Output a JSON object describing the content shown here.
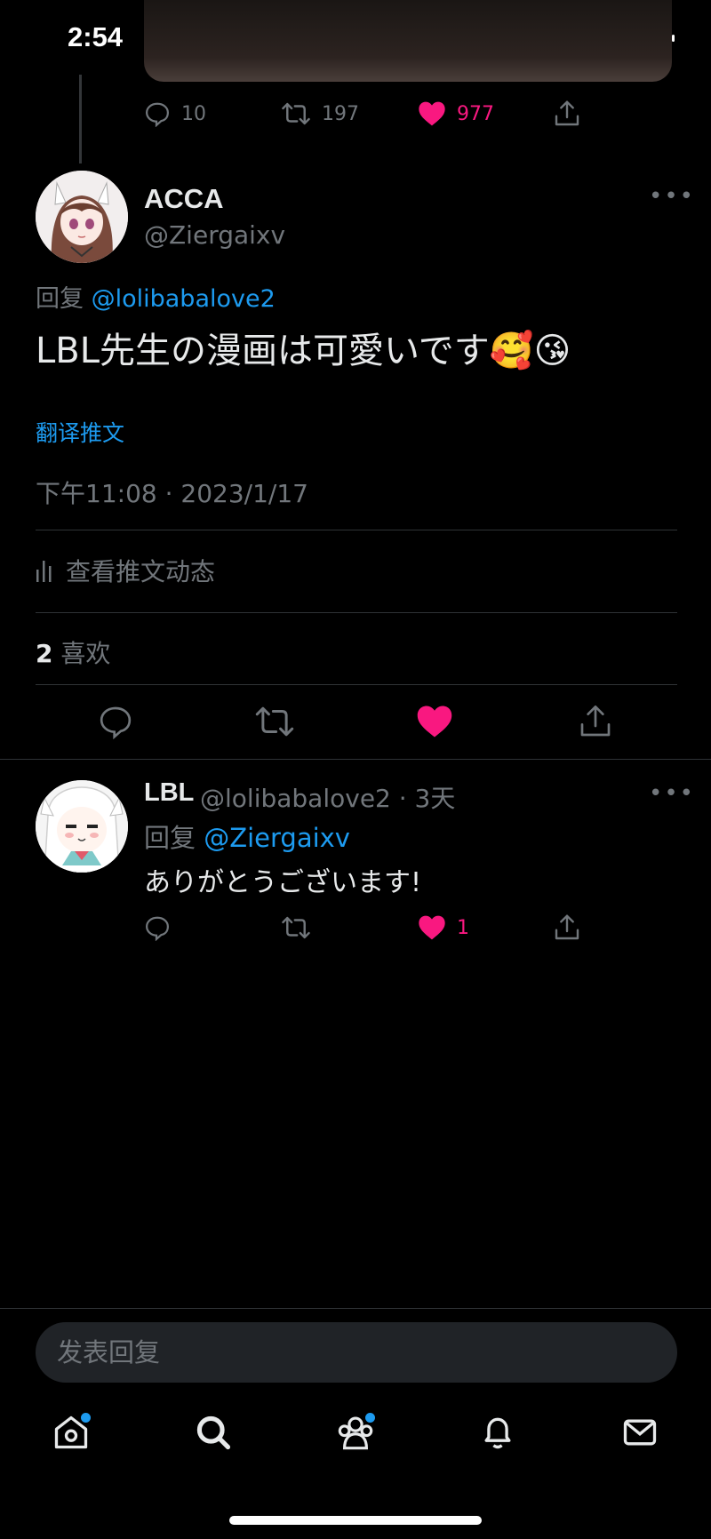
{
  "status_bar": {
    "time": "2:54"
  },
  "previous_tweet": {
    "reply_count": "10",
    "retweet_count": "197",
    "like_count": "977"
  },
  "main_tweet": {
    "name": "ACCA",
    "handle": "@Ziergaixv",
    "reply_prefix": "回复",
    "reply_mention": "@lolibabalove2",
    "text": "LBL先生の漫画は可愛いです🥰😘",
    "translate_label": "翻译推文",
    "timestamp": "下午11:08 · 2023/1/17",
    "analytics_label": "查看推文动态",
    "likes_number": "2",
    "likes_label": "喜欢"
  },
  "reply_tweet": {
    "name": "LBL",
    "handle_time": "@lolibabalove2 · 3天",
    "reply_prefix": "回复",
    "reply_mention": "@Ziergaixv",
    "text": "ありがとうございます!",
    "like_count": "1"
  },
  "composer": {
    "placeholder": "发表回复"
  },
  "colors": {
    "accent": "#1d9bf0",
    "like": "#f91880",
    "muted": "#71767b",
    "background": "#000000"
  },
  "tab_bar": {
    "tabs": [
      "home-icon",
      "search-icon",
      "communities-icon",
      "bell-icon",
      "mail-icon"
    ]
  }
}
